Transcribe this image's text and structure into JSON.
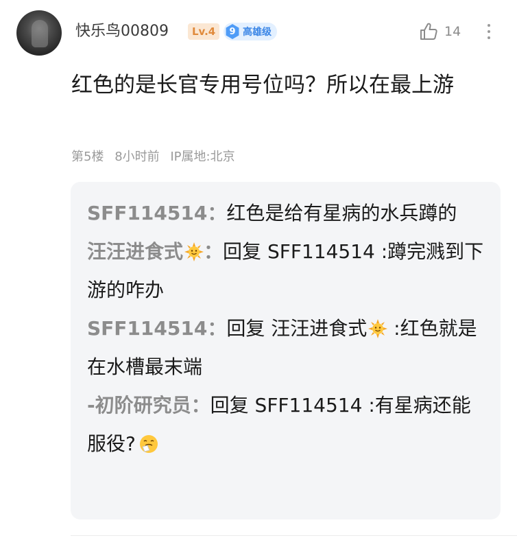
{
  "post": {
    "username": "快乐鸟00809",
    "level": "Lv.4",
    "rank_number": "9",
    "rank_label": "高雄级",
    "like_count": "14",
    "text": "红色的是长官专用号位吗？所以在最上游",
    "floor": "第5楼",
    "time": "8小时前",
    "ip_location": "IP属地:北京"
  },
  "replies": [
    {
      "author": "SFF114514",
      "separator": "：",
      "reply_prefix": "",
      "target": "",
      "target_emoji": "",
      "target_separator": "",
      "text": "红色是给有星病的水兵蹲的",
      "author_emoji": "",
      "trailing_emoji": ""
    },
    {
      "author": "汪汪进食式",
      "author_emoji": "sun-face-emoji",
      "separator": "：",
      "reply_prefix": "回复 ",
      "target": "SFF114514",
      "target_emoji": "",
      "target_separator": " :",
      "text": "蹲完溅到下游的咋办",
      "trailing_emoji": ""
    },
    {
      "author": "SFF114514",
      "author_emoji": "",
      "separator": "：",
      "reply_prefix": "回复 ",
      "target": "汪汪进食式",
      "target_emoji": "sun-face-emoji",
      "target_separator": " :",
      "text": "红色就是在水槽最末端",
      "trailing_emoji": ""
    },
    {
      "author": "-初阶研究员",
      "author_emoji": "",
      "separator": "：",
      "reply_prefix": "回复 ",
      "target": "SFF114514",
      "target_emoji": "",
      "target_separator": " :",
      "text": "有星病还能服役?",
      "trailing_emoji": "sneezing-face-emoji"
    }
  ],
  "colors": {
    "author_gray": "#8c8c8c",
    "level_bg": "#fbe7d3",
    "level_text": "#e08a3c",
    "rank_bg": "#e3f0ff",
    "rank_accent": "#4f9cf7",
    "reply_box_bg": "#f4f5f7"
  }
}
